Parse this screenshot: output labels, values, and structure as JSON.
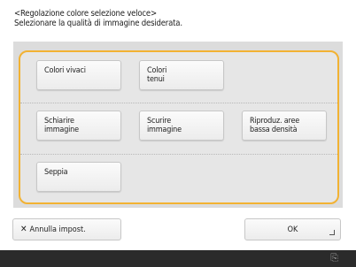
{
  "header": {
    "title": "<Regolazione colore selezione veloce>",
    "subtitle": "Selezionare la qualità di immagine desiderata."
  },
  "options": [
    {
      "label": "Colori vivaci"
    },
    {
      "label": "Colori\ntenui"
    },
    {
      "label": "Schiarire\nimmagine"
    },
    {
      "label": "Scurire\nimmagine"
    },
    {
      "label": "Riproduz. aree\nbassa densità"
    },
    {
      "label": "Seppia"
    }
  ],
  "footer": {
    "cancel_label": "Annulla impost.",
    "ok_label": "OK"
  },
  "statusbar": {
    "icon": "network-icon"
  },
  "colors": {
    "accent_frame": "#f2b233",
    "status_bar": "#2b2b2b"
  }
}
